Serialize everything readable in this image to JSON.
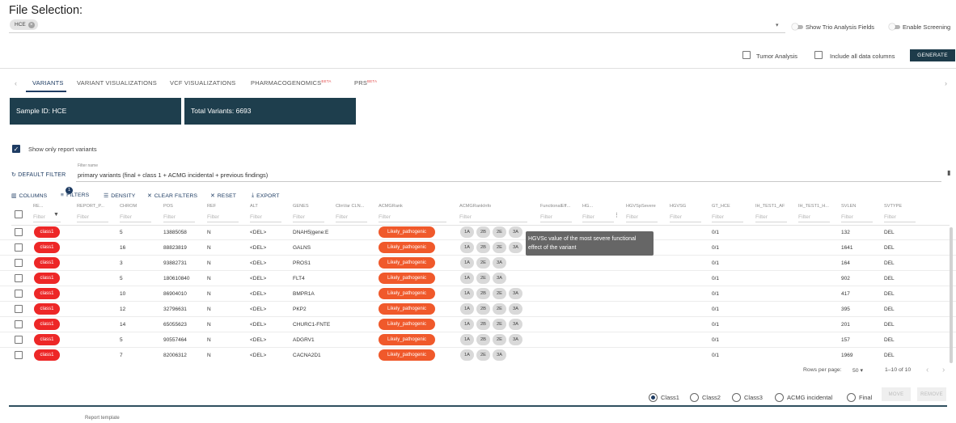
{
  "file_selection": {
    "title": "File Selection:",
    "chip": "HCE",
    "dropdown_icon": "▾",
    "toggle_trio": "Show Trio Analysis Fields",
    "toggle_screening": "Enable Screening"
  },
  "options": {
    "tumor": "Tumor Analysis",
    "include_all": "Include all data columns",
    "generate": "GENERATE"
  },
  "tabs": [
    {
      "label": "VARIANTS",
      "beta": ""
    },
    {
      "label": "VARIANT VISUALIZATIONS",
      "beta": ""
    },
    {
      "label": "VCF VISUALIZATIONS",
      "beta": ""
    },
    {
      "label": "PHARMACOGENOMICS",
      "beta": "BETA"
    },
    {
      "label": "PRS",
      "beta": "BETA"
    }
  ],
  "cards": {
    "sample": "Sample ID: HCE",
    "total": "Total Variants: 6693"
  },
  "report_only": {
    "label": "Show only report variants",
    "checked": true
  },
  "filter": {
    "default_label": "DEFAULT FILTER",
    "name_label": "Filter name",
    "value": "primary variants (final + class 1 + ACMG incidental + previous findings)"
  },
  "toolbar": {
    "columns": "COLUMNS",
    "filters": "FILTERS",
    "filter_count": "1",
    "density": "DENSITY",
    "clear": "CLEAR FILTERS",
    "reset": "RESET",
    "export": "EXPORT"
  },
  "table": {
    "filter_placeholder": "Filter",
    "columns": [
      "RE...",
      "REPORT_P...",
      "CHROM",
      "POS",
      "REF",
      "ALT",
      "GENES",
      "ClinVar CLN...",
      "ACMGRank",
      "ACMGRankInfo",
      "FunctionalEff...",
      "HG...",
      "HGVSpSevere",
      "HGVSG",
      "GT_HCE",
      "IH_TEST1_AF",
      "IH_TEST1_H...",
      "SVLEN",
      "SVTYPE"
    ],
    "rows": [
      {
        "cls": "class1",
        "chrom": "5",
        "pos": "13885058",
        "ref": "N",
        "alt": "<DEL>",
        "genes": "DNAH5|gene:E",
        "acmg": "Likely_pathogenic",
        "rank": [
          "1A",
          "2B",
          "2E",
          "3A"
        ],
        "gt": "0/1",
        "svlen": "132",
        "svtype": "DEL"
      },
      {
        "cls": "class1",
        "chrom": "16",
        "pos": "88823819",
        "ref": "N",
        "alt": "<DEL>",
        "genes": "GALNS",
        "acmg": "Likely_pathogenic",
        "rank": [
          "1A",
          "2B",
          "2E",
          "3A"
        ],
        "gt": "0/1",
        "svlen": "1641",
        "svtype": "DEL"
      },
      {
        "cls": "class1",
        "chrom": "3",
        "pos": "93882731",
        "ref": "N",
        "alt": "<DEL>",
        "genes": "PROS1",
        "acmg": "Likely_pathogenic",
        "rank": [
          "1A",
          "2E",
          "3A"
        ],
        "gt": "0/1",
        "svlen": "164",
        "svtype": "DEL"
      },
      {
        "cls": "class1",
        "chrom": "5",
        "pos": "180610840",
        "ref": "N",
        "alt": "<DEL>",
        "genes": "FLT4",
        "acmg": "Likely_pathogenic",
        "rank": [
          "1A",
          "2E",
          "3A"
        ],
        "gt": "0/1",
        "svlen": "902",
        "svtype": "DEL"
      },
      {
        "cls": "class1",
        "chrom": "10",
        "pos": "86904010",
        "ref": "N",
        "alt": "<DEL>",
        "genes": "BMPR1A",
        "acmg": "Likely_pathogenic",
        "rank": [
          "1A",
          "2B",
          "2E",
          "3A"
        ],
        "gt": "0/1",
        "svlen": "417",
        "svtype": "DEL"
      },
      {
        "cls": "class1",
        "chrom": "12",
        "pos": "32796631",
        "ref": "N",
        "alt": "<DEL>",
        "genes": "PKP2",
        "acmg": "Likely_pathogenic",
        "rank": [
          "1A",
          "2B",
          "2E",
          "3A"
        ],
        "gt": "0/1",
        "svlen": "395",
        "svtype": "DEL"
      },
      {
        "cls": "class1",
        "chrom": "14",
        "pos": "65055623",
        "ref": "N",
        "alt": "<DEL>",
        "genes": "CHURC1-FNTE",
        "acmg": "Likely_pathogenic",
        "rank": [
          "1A",
          "2B",
          "2E",
          "3A"
        ],
        "gt": "0/1",
        "svlen": "201",
        "svtype": "DEL"
      },
      {
        "cls": "class1",
        "chrom": "5",
        "pos": "90557464",
        "ref": "N",
        "alt": "<DEL>",
        "genes": "ADGRV1",
        "acmg": "Likely_pathogenic",
        "rank": [
          "1A",
          "2B",
          "2E",
          "3A"
        ],
        "gt": "0/1",
        "svlen": "157",
        "svtype": "DEL"
      },
      {
        "cls": "class1",
        "chrom": "7",
        "pos": "82006312",
        "ref": "N",
        "alt": "<DEL>",
        "genes": "CACNA2D1",
        "acmg": "Likely_pathogenic",
        "rank": [
          "1A",
          "2E",
          "3A"
        ],
        "gt": "0/1",
        "svlen": "1969",
        "svtype": "DEL"
      }
    ]
  },
  "tooltip": "HGVSc value of the most severe functional effect of the variant",
  "pagination": {
    "rows_label": "Rows per page:",
    "rows_value": "50",
    "range": "1–10 of 10"
  },
  "classify": {
    "options": [
      "Class1",
      "Class2",
      "Class3",
      "ACMG incidental",
      "Final"
    ],
    "selected": "Class1",
    "move": "MOVE",
    "remove": "REMOVE"
  },
  "footer": {
    "report_template": "Report template"
  },
  "colors": {
    "primary": "#1e3c63",
    "card": "#1e3e4d",
    "class": "#ed2727",
    "acmg": "#f0592b"
  }
}
